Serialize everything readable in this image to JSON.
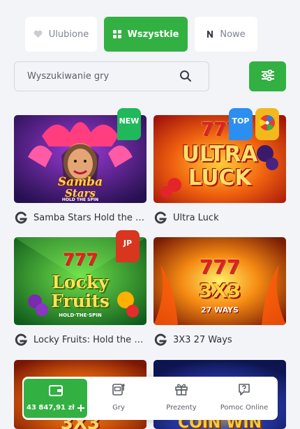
{
  "tabs": [
    {
      "label": "Ulubione",
      "icon": "heart-icon",
      "active": false
    },
    {
      "label": "Wszystkie",
      "icon": "grid-icon",
      "active": true
    },
    {
      "label": "Nowe",
      "icon": "n-letter-icon",
      "active": false
    }
  ],
  "search": {
    "placeholder": "Wyszukiwanie gry",
    "icon": "search-icon"
  },
  "filter": {
    "icon": "sliders-icon"
  },
  "games": [
    {
      "name": "Samba Stars Hold the S…",
      "badge": "NEW",
      "provider_icon": "g-provider-icon",
      "art_text": [
        "Samba",
        "Stars",
        "HOLD THE SPIN"
      ]
    },
    {
      "name": "Ultra Luck",
      "badge": "TOP",
      "provider_icon": "g-provider-icon",
      "art_text": [
        "777",
        "ULTRA",
        "LUCK"
      ]
    },
    {
      "name": "Locky Fruits: Hold the S…",
      "badge": "JP",
      "provider_icon": "g-provider-icon",
      "art_text": [
        "777",
        "Locky",
        "Fruits",
        "HOLD·THE·SPIN"
      ]
    },
    {
      "name": "3X3 27 Ways",
      "badge": "",
      "provider_icon": "g-provider-icon",
      "art_text": [
        "777",
        "3X3",
        "27 WAYS"
      ]
    },
    {
      "name": "",
      "badge": "",
      "provider_icon": "",
      "art_text": [
        "3X3"
      ]
    },
    {
      "name": "",
      "badge": "",
      "provider_icon": "",
      "art_text": [
        "COIN WIN"
      ]
    }
  ],
  "bottom_nav": {
    "balance": "43 847,91 zł",
    "items": [
      {
        "label": "Gry",
        "icon": "slot-machine-icon"
      },
      {
        "label": "Prezenty",
        "icon": "gift-icon"
      },
      {
        "label": "Pomoc Online",
        "icon": "help-chat-icon"
      }
    ]
  },
  "colors": {
    "accent": "#33b042",
    "badge_new": "#1fb85a",
    "badge_top": "#2b8ef0",
    "badge_jp": "#d8361f"
  }
}
